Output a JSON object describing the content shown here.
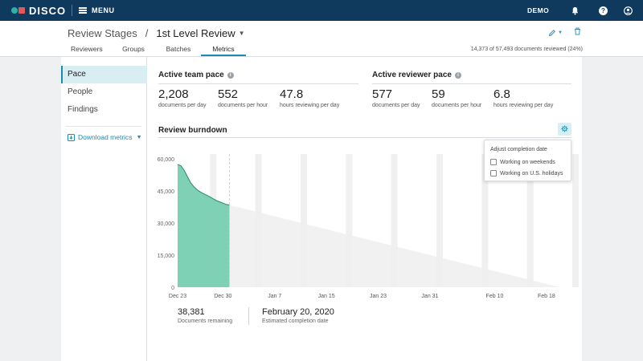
{
  "topbar": {
    "logo_text": "DISCO",
    "menu_label": "MENU",
    "user_label": "DEMO",
    "icons": [
      "bell-icon",
      "help-icon",
      "user-icon"
    ],
    "colors": {
      "bar": "#0f3a5e",
      "logo_teal": "#2bb3a3",
      "logo_red": "#e05a5a"
    }
  },
  "header": {
    "breadcrumb_parent": "Review Stages",
    "breadcrumb_sep": "/",
    "breadcrumb_current": "1st Level Review",
    "reviewed_text": "14,373 of 57,493 documents reviewed (24%)",
    "tabs": [
      {
        "label": "Reviewers",
        "active": false
      },
      {
        "label": "Groups",
        "active": false
      },
      {
        "label": "Batches",
        "active": false
      },
      {
        "label": "Metrics",
        "active": true
      }
    ]
  },
  "sidebar": {
    "items": [
      {
        "label": "Pace",
        "active": true
      },
      {
        "label": "People",
        "active": false
      },
      {
        "label": "Findings",
        "active": false
      }
    ],
    "download_label": "Download metrics"
  },
  "team_pace": {
    "title": "Active team pace",
    "stats": [
      {
        "value": "2,208",
        "label": "documents per day"
      },
      {
        "value": "552",
        "label": "documents per hour"
      },
      {
        "value": "47.8",
        "label": "hours reviewing per day"
      }
    ]
  },
  "reviewer_pace": {
    "title": "Active reviewer pace",
    "stats": [
      {
        "value": "577",
        "label": "documents per day"
      },
      {
        "value": "59",
        "label": "documents per hour"
      },
      {
        "value": "6.8",
        "label": "hours reviewing per day"
      }
    ]
  },
  "burndown": {
    "title": "Review burndown",
    "popover": {
      "title": "Adjust completion date",
      "options": [
        {
          "label": "Working on weekends",
          "checked": false
        },
        {
          "label": "Working on U.S. holidays",
          "checked": false
        }
      ]
    },
    "remaining_value": "38,381",
    "remaining_label": "Documents remaining",
    "completion_value": "February 20, 2020",
    "completion_label": "Estimated completion date"
  },
  "chart_data": {
    "type": "area",
    "title": "Review burndown",
    "ylim": [
      0,
      60000
    ],
    "y_ticks": [
      "60,000",
      "45,000",
      "30,000",
      "15,000",
      "0"
    ],
    "y_tick_values": [
      60000,
      45000,
      30000,
      15000,
      0
    ],
    "x_ticks": [
      "Dec 23",
      "Dec 30",
      "Jan 7",
      "Jan 15",
      "Jan 23",
      "Jan 31",
      "Feb 10",
      "Feb 18"
    ],
    "actual": {
      "days": [
        0,
        0.5,
        1,
        1.5,
        2,
        2.5,
        3,
        3.5,
        4,
        4.5,
        5,
        5.5,
        6,
        6.5,
        7,
        7.5,
        8
      ],
      "remaining": [
        57400,
        56800,
        54700,
        51800,
        48900,
        47000,
        45600,
        44500,
        43700,
        43000,
        42200,
        41300,
        40500,
        39900,
        39300,
        38700,
        38381
      ]
    },
    "projection": {
      "start_remaining": 38381,
      "end_remaining": 0
    },
    "colors": {
      "actual": "#7fd1b6",
      "actual_line": "#2a8a6c",
      "projection": "#eeeeee",
      "weekend_band": "#f0f0f0",
      "today_line": "#c8c8c8"
    }
  }
}
